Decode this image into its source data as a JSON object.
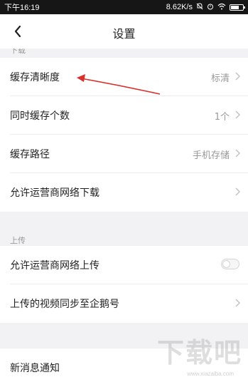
{
  "status_bar": {
    "time": "下午16:19",
    "net_speed": "8.62K/s",
    "icons": [
      "mute-icon",
      "alarm-icon",
      "wifi-icon",
      "battery-icon"
    ],
    "battery_level": 0.7
  },
  "header": {
    "back_icon": "chevron-left-icon",
    "title": "设置"
  },
  "sections": {
    "download": {
      "title": "下载",
      "items": [
        {
          "label": "缓存清晰度",
          "value": "标清"
        },
        {
          "label": "同时缓存个数",
          "value": "1个"
        },
        {
          "label": "缓存路径",
          "value": "手机存储"
        },
        {
          "label": "允许运营商网络下载",
          "value": ""
        }
      ]
    },
    "upload": {
      "title": "上传",
      "items": [
        {
          "label": "允许运营商网络上传",
          "toggle": false
        },
        {
          "label": "上传的视频同步至企鹅号",
          "value": ""
        }
      ]
    },
    "other": {
      "items": [
        {
          "label": "新消息通知"
        }
      ]
    }
  },
  "annotation": {
    "color": "#d9302c"
  },
  "watermark": {
    "text": "下载吧",
    "url": "www.xiazaiba.com"
  },
  "colors": {
    "accent_arrow": "#d9302c",
    "chevron": "#c4c4c4",
    "text": "#222222",
    "secondary": "#999999"
  }
}
